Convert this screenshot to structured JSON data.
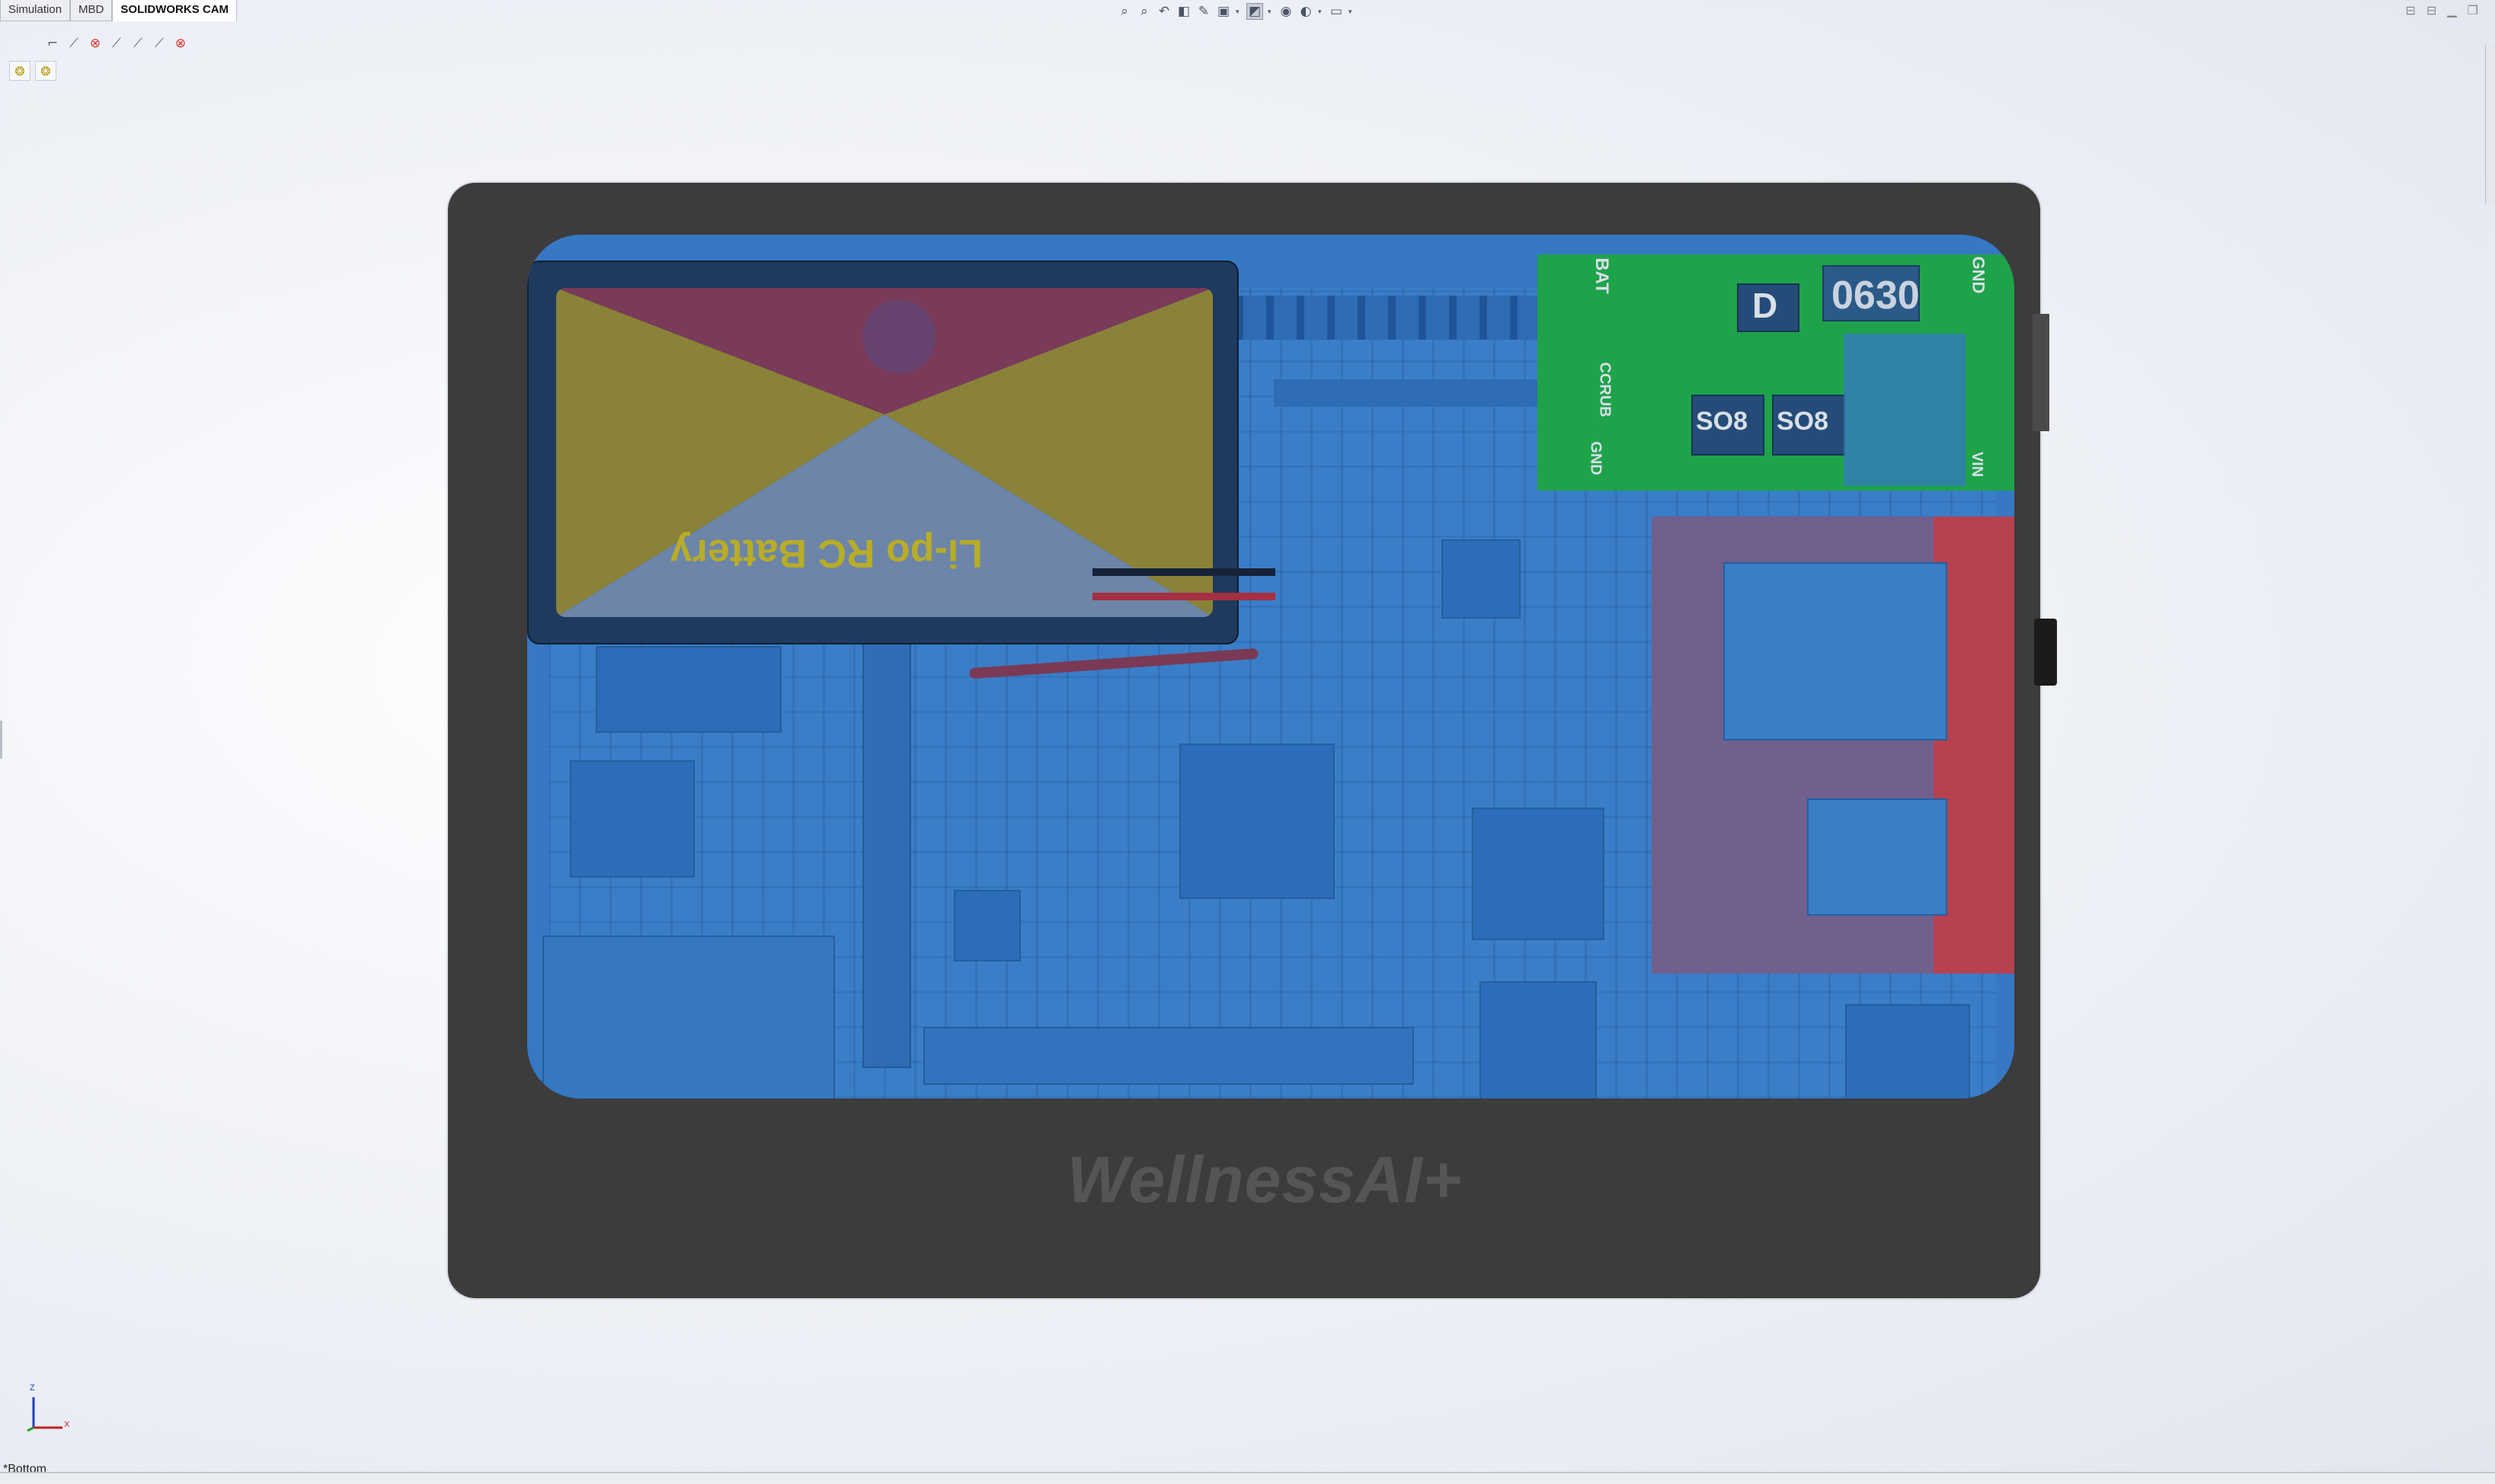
{
  "tabs": [
    {
      "label": "Simulation",
      "active": false
    },
    {
      "label": "MBD",
      "active": false
    },
    {
      "label": "SOLIDWORKS CAM",
      "active": true
    }
  ],
  "hud_icons": [
    "zoom-to-fit-icon",
    "zoom-area-icon",
    "previous-view-icon",
    "section-view-icon",
    "dynamic-annotation-icon",
    "view-orientation-icon",
    "display-style-icon",
    "hide-show-items-icon",
    "edit-appearance-icon",
    "apply-scene-icon",
    "view-settings-icon"
  ],
  "feature_icons": [
    "sketch-icon",
    "close-icon",
    "smart-dimension-icon",
    "line-icon",
    "close-icon"
  ],
  "model": {
    "brand_text": "WellnessAI+",
    "battery_label": "Li-po  RC Battery",
    "module_labels": {
      "bat": "BAT",
      "gnd_top": "GND",
      "ccrub": "CCRUB",
      "gnd_left": "GND",
      "vin": "VIN",
      "ic_code": "0630",
      "d": "D",
      "so8_a": "SO8",
      "so8_b": "SO8"
    }
  },
  "triad": {
    "z": "Z",
    "x": "X"
  },
  "view_name": "*Bottom",
  "colors": {
    "device_body": "#3c3c3c",
    "pcb_blue": "#3678c3",
    "green_module": "#1fa34a",
    "red_module": "#b8414f",
    "battery_yellow": "#d4c21e"
  }
}
